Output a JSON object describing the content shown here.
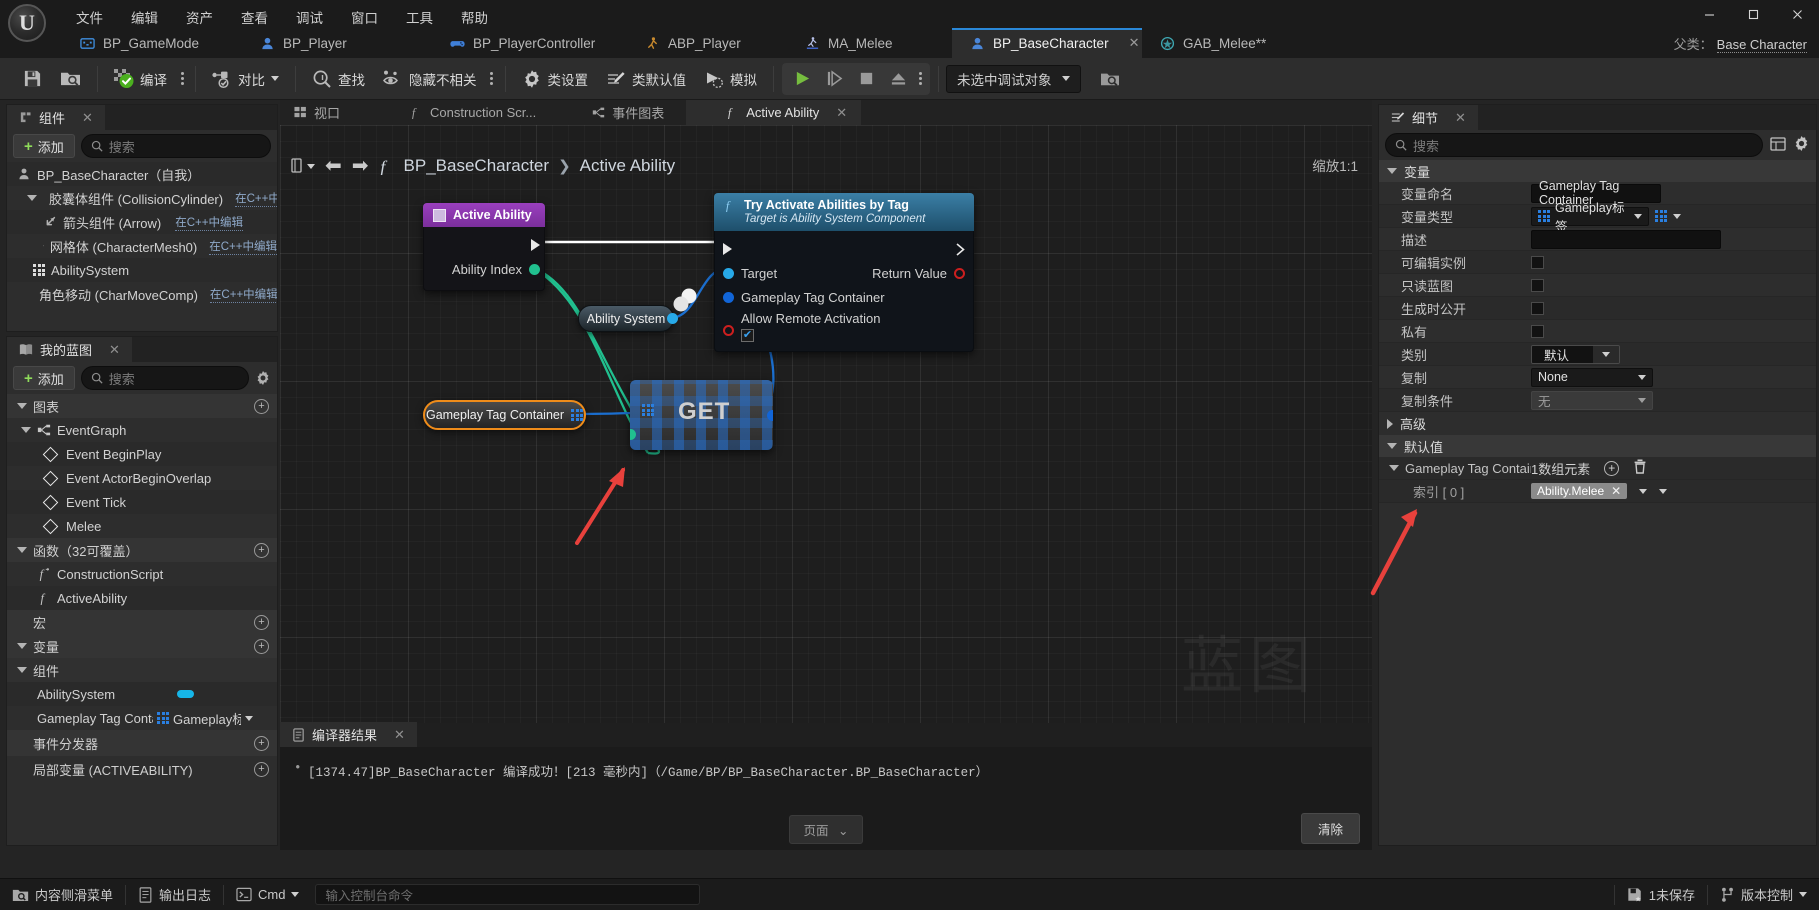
{
  "app": {
    "logo": "ue-logo",
    "menu": [
      "文件",
      "编辑",
      "资产",
      "查看",
      "调试",
      "窗口",
      "工具",
      "帮助"
    ],
    "window_controls": {
      "minimize": "—",
      "maximize": "▢",
      "close": "✕"
    }
  },
  "asset_tabs": [
    {
      "label": "BP_GameMode",
      "icon": "gamemode-icon",
      "active": false
    },
    {
      "label": "BP_Player",
      "icon": "character-icon",
      "active": false
    },
    {
      "label": "BP_PlayerController",
      "icon": "controller-icon",
      "active": false
    },
    {
      "label": "ABP_Player",
      "icon": "animblueprint-icon",
      "active": false
    },
    {
      "label": "MA_Melee",
      "icon": "montage-icon",
      "active": false
    },
    {
      "label": "BP_BaseCharacter",
      "icon": "character-icon",
      "active": true,
      "close": "✕"
    },
    {
      "label": "GAB_Melee**",
      "icon": "ability-icon",
      "active": false
    }
  ],
  "parent_class": {
    "label": "父类：",
    "value": "Base Character"
  },
  "toolbar": {
    "save": "save-icon",
    "browse": "browse-icon",
    "compile": "编译",
    "diff": "对比",
    "find": "查找",
    "hide_unrelated": "隐藏不相关",
    "class_settings": "类设置",
    "class_defaults": "类默认值",
    "simulate": "模拟",
    "play": "play-icon",
    "step": "step-icon",
    "stop": "stop-icon",
    "eject": "eject-icon",
    "debug_object": "未选中调试对象"
  },
  "components_panel": {
    "tab": "组件",
    "tab_close": "✕",
    "add": "添加",
    "search_placeholder": "搜索",
    "items": [
      {
        "label": "BP_BaseCharacter（自我）",
        "indent": 0,
        "icon": "character-icon",
        "suffix": ""
      },
      {
        "label": "胶囊体组件 (CollisionCylinder)",
        "indent": 1,
        "icon": "capsule-icon",
        "suffix": "在C++中编辑",
        "expander": true
      },
      {
        "label": "箭头组件 (Arrow)",
        "indent": 2,
        "icon": "arrow-icon",
        "suffix": "在C++中编辑"
      },
      {
        "label": "网格体 (CharacterMesh0)",
        "indent": 2,
        "icon": "mesh-icon",
        "suffix": "在C++中编辑"
      },
      {
        "label": "AbilitySystem",
        "indent": 1,
        "icon": "ability-grid-icon",
        "suffix": ""
      },
      {
        "label": "角色移动 (CharMoveComp)",
        "indent": 1,
        "icon": "charmove-icon",
        "suffix": "在C++中编辑"
      }
    ]
  },
  "myblueprint_panel": {
    "tab": "我的蓝图",
    "tab_close": "✕",
    "add": "添加",
    "search_placeholder": "搜索",
    "sections": [
      {
        "type": "section",
        "label": "图表",
        "plus": true,
        "expanded": true
      },
      {
        "type": "graph",
        "label": "EventGraph",
        "expanded": true
      },
      {
        "type": "event",
        "label": "Event BeginPlay"
      },
      {
        "type": "event",
        "label": "Event ActorBeginOverlap"
      },
      {
        "type": "event",
        "label": "Event Tick"
      },
      {
        "type": "event",
        "label": "Melee"
      },
      {
        "type": "section",
        "label": "函数（32可覆盖）",
        "plus": true,
        "expanded": true
      },
      {
        "type": "func",
        "label": "ConstructionScript"
      },
      {
        "type": "func",
        "label": "ActiveAbility"
      },
      {
        "type": "section",
        "label": "宏",
        "plus": true,
        "expanded": false
      },
      {
        "type": "section",
        "label": "变量",
        "plus": true,
        "expanded": true
      },
      {
        "type": "subsection",
        "label": "组件",
        "expanded": true
      },
      {
        "type": "var",
        "label": "AbilitySystem",
        "value_kind": "bool-pill"
      },
      {
        "type": "var",
        "label": "Gameplay Tag Container",
        "value_kind": "tag",
        "value": "Gameplay标签"
      },
      {
        "type": "section",
        "label": "事件分发器",
        "plus": true,
        "expanded": false
      },
      {
        "type": "section",
        "label": "局部变量 (ACTIVEABILITY)",
        "plus": true,
        "expanded": false
      }
    ]
  },
  "graph": {
    "tabs": [
      {
        "label": "视口",
        "icon": "viewport-icon",
        "active": false
      },
      {
        "label": "Construction Scr...",
        "icon": "function-icon",
        "active": false
      },
      {
        "label": "事件图表",
        "icon": "graph-icon",
        "active": false
      },
      {
        "label": "Active Ability",
        "icon": "function-icon",
        "active": true,
        "close": "✕"
      }
    ],
    "breadcrumb": {
      "root": "BP_BaseCharacter",
      "sep": "❯",
      "leaf": "Active Ability"
    },
    "zoom": "缩放1:1",
    "watermark": "蓝图",
    "nodes": {
      "entry": {
        "title": "Active Ability",
        "pins": [
          {
            "label": "Ability Index",
            "kind": "data-green"
          }
        ]
      },
      "tryactivate": {
        "title": "Try Activate Abilities by Tag",
        "subtitle": "Target is Ability System Component",
        "inputs": [
          {
            "label": "Target",
            "kind": "object-blue"
          },
          {
            "label": "Gameplay Tag Container",
            "kind": "struct-blue"
          },
          {
            "label": "Allow Remote Activation",
            "kind": "bool-red",
            "checked": true
          }
        ],
        "outputs": [
          {
            "label": "Return Value",
            "kind": "bool-red"
          }
        ]
      },
      "abilitysystem": {
        "title": "Ability System"
      },
      "gameplaytagcontainer": {
        "title": "Gameplay Tag Container",
        "selected": true
      },
      "get": {
        "title": "GET"
      }
    }
  },
  "compiler_results": {
    "tab": "编译器结果",
    "tab_close": "✕",
    "message": "[1374.47]BP_BaseCharacter 编译成功！[213 毫秒内]（/Game/BP/BP_BaseCharacter.BP_BaseCharacter）",
    "page_button": "页面",
    "clear_button": "清除"
  },
  "details_panel": {
    "tab": "细节",
    "tab_close": "✕",
    "search_placeholder": "搜索",
    "sections": {
      "variable": "变量",
      "advanced": "高级",
      "defaults": "默认值"
    },
    "rows": [
      {
        "label": "变量命名",
        "type": "text",
        "value": "Gameplay Tag Container"
      },
      {
        "label": "变量类型",
        "type": "typepicker",
        "value": "Gameplay标签"
      },
      {
        "label": "描述",
        "type": "text",
        "value": ""
      },
      {
        "label": "可编辑实例",
        "type": "checkbox",
        "value": false
      },
      {
        "label": "只读蓝图",
        "type": "checkbox",
        "value": false
      },
      {
        "label": "生成时公开",
        "type": "checkbox",
        "value": false
      },
      {
        "label": "私有",
        "type": "checkbox",
        "value": false
      },
      {
        "label": "类别",
        "type": "combo",
        "value": "默认"
      },
      {
        "label": "复制",
        "type": "dropdown",
        "value": "None"
      },
      {
        "label": "复制条件",
        "type": "dropdown-disabled",
        "value": "无"
      }
    ],
    "default_value": {
      "array_label": "Gameplay Tag Container",
      "array_count": "1数组元素",
      "add_icon": "add-circle-icon",
      "delete_icon": "trash-icon",
      "index_label": "索引 [ 0 ]",
      "tag_value": "Ability.Melee"
    }
  },
  "statusbar": {
    "content_drawer": "内容侧滑菜单",
    "output_log": "输出日志",
    "cmd": "Cmd",
    "console_placeholder": "输入控制台命令",
    "unsaved": "1未保存",
    "source_control": "版本控制"
  },
  "colors": {
    "accent_blue": "#2a88d8",
    "node_purple": "#8a3fb0",
    "node_func_blue": "#2e6f94",
    "exec_white": "#ffffff",
    "wire_green": "#21c08f",
    "wire_blue": "#1b6fd0",
    "selected_orange": "#ef8c1a",
    "compile_green": "#8fdc5a",
    "annotation_red": "#e8413c"
  }
}
